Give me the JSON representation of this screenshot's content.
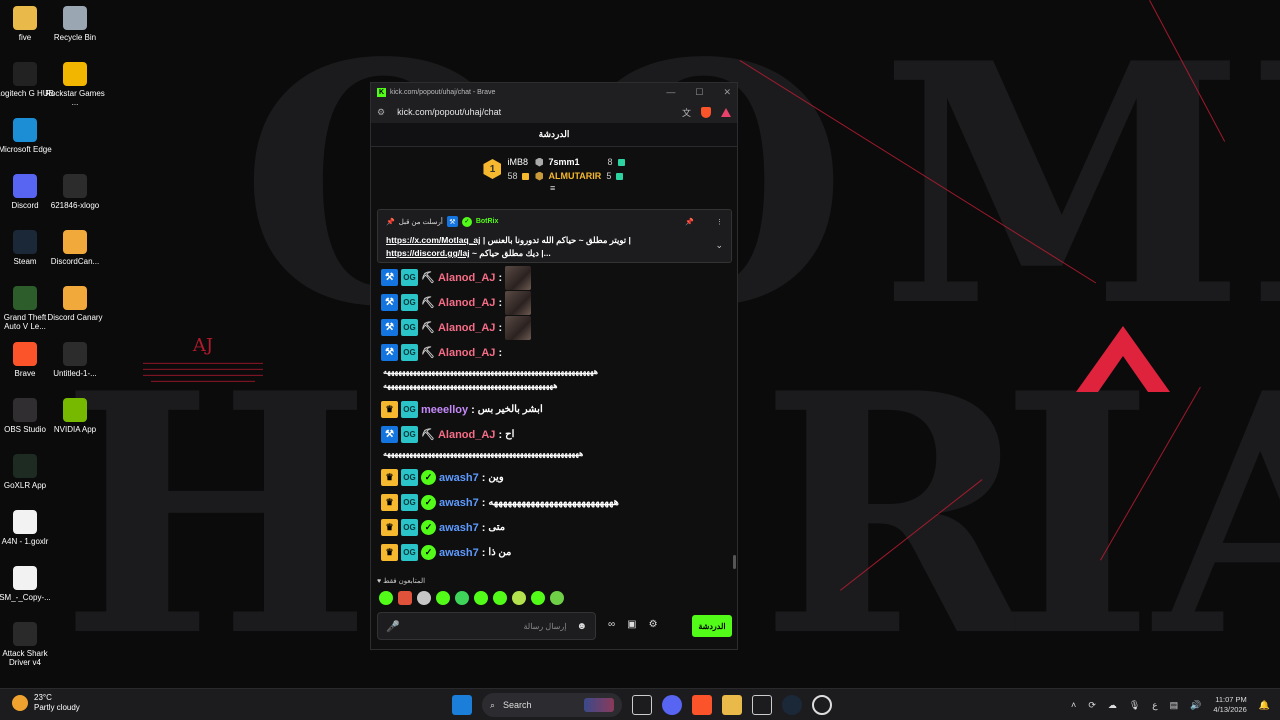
{
  "desktop_icons": [
    {
      "label": "five",
      "icon": "folder-icon",
      "color": "#e9b949"
    },
    {
      "label": "Recycle Bin",
      "icon": "recycle-bin-icon",
      "color": "#9aa6b2"
    },
    {
      "label": "Logitech G HUB",
      "icon": "logitech-icon",
      "color": "#222222"
    },
    {
      "label": "Rockstar Games ...",
      "icon": "rockstar-icon",
      "color": "#f2b600"
    },
    {
      "label": "Microsoft Edge",
      "icon": "edge-icon",
      "color": "#1b8ed6"
    },
    {
      "label": "Discord",
      "icon": "discord-icon",
      "color": "#5865f2"
    },
    {
      "label": "621846-xlogo",
      "icon": "image-file-icon",
      "color": "#2c2c2c"
    },
    {
      "label": "Steam",
      "icon": "steam-icon",
      "color": "#1b2838"
    },
    {
      "label": "DiscordCan...",
      "icon": "discord-canary-icon",
      "color": "#f2a93b"
    },
    {
      "label": "Grand Theft Auto V Le...",
      "icon": "gta-icon",
      "color": "#2d5d2a"
    },
    {
      "label": "Discord Canary",
      "icon": "discord-canary-icon",
      "color": "#f2a93b"
    },
    {
      "label": "Brave",
      "icon": "brave-icon",
      "color": "#fb542b"
    },
    {
      "label": "Untitled-1-...",
      "icon": "file-icon",
      "color": "#2c2c2c"
    },
    {
      "label": "OBS Studio",
      "icon": "obs-icon",
      "color": "#302e31"
    },
    {
      "label": "NVIDIA App",
      "icon": "nvidia-icon",
      "color": "#76b900"
    },
    {
      "label": "GoXLR App",
      "icon": "goxlr-icon",
      "color": "#1d2b22"
    },
    {
      "label": "A4N - 1.goxlr",
      "icon": "document-icon",
      "color": "#f2f2f2"
    },
    {
      "label": "SM_-_Copy-...",
      "icon": "document-icon",
      "color": "#f2f2f2"
    },
    {
      "label": "Attack Shark Driver v4",
      "icon": "mouse-driver-icon",
      "color": "#2a2a2a"
    }
  ],
  "wallpaper": {
    "aj_title": "AJ",
    "accent": "#c41d33"
  },
  "browser": {
    "tab_title": "kick.com/popout/uhaj/chat - Brave",
    "url": "kick.com/popout/uhaj/chat",
    "minimize": "—",
    "maximize": "☐",
    "close": "✕"
  },
  "chat": {
    "header": "الدردشة",
    "leaderboard": {
      "rank": "1",
      "first": {
        "name": "iMB8",
        "count": "58"
      },
      "second": {
        "name": "7smm1",
        "count": "8"
      },
      "third": {
        "name": "ALMUTARIR",
        "count": "5"
      }
    },
    "pinned": {
      "sent_by": "أرسلت من قبل",
      "bot": "BotRix",
      "line1_link": "https://x.com/Motlaq_aj",
      "line1_text": "| تويتر مطلق ~ حياكم الله تدورونا بالعنس |",
      "line2_link": "https://discord.gg/laj",
      "line2_text": "~ ديك مطلق حياكم |..."
    },
    "messages": [
      {
        "user": "Alanod_AJ",
        "text": "",
        "badges": "mod",
        "color": "#f76d86",
        "thumb": true
      },
      {
        "user": "Alanod_AJ",
        "text": "",
        "badges": "mod",
        "color": "#f76d86",
        "thumb": true
      },
      {
        "user": "Alanod_AJ",
        "text": "",
        "badges": "mod",
        "color": "#f76d86",
        "thumb": true
      },
      {
        "user": "Alanod_AJ",
        "text": "",
        "badges": "mod",
        "color": "#f76d86",
        "thumb": false
      },
      {
        "user": "meeelloy",
        "text": "ابشر بالخير بس",
        "badges": "sub",
        "color": "#c58af9",
        "thumb": false
      },
      {
        "user": "Alanod_AJ",
        "text": "اح",
        "badges": "mod",
        "color": "#f76d86",
        "thumb": false
      },
      {
        "user": "awash7",
        "text": "وين",
        "badges": "verified",
        "color": "#5e9bff",
        "thumb": false
      },
      {
        "user": "awash7",
        "text": "هههههههههههههههههههههههههههه",
        "badges": "verified",
        "color": "#5e9bff",
        "thumb": false
      },
      {
        "user": "awash7",
        "text": "متى",
        "badges": "verified",
        "color": "#5e9bff",
        "thumb": false
      },
      {
        "user": "awash7",
        "text": "من ذا",
        "badges": "verified",
        "color": "#5e9bff",
        "thumb": false
      }
    ],
    "spam_line_1": "هههههههههههههههههههههههههههههههههههههههههههههههههههههههههه",
    "spam_line_2": "ههههههههههههههههههههههههههههههههههههههههههههههه",
    "spam_line_3": "هههههههههههههههههههههههههههههههههههههههههههههههههههههه",
    "followers_only": "المتابعون فقط",
    "input_placeholder": "إرسال رسالة",
    "chat_button": "الدردشة"
  },
  "taskbar": {
    "temperature": "23°C",
    "weather": "Partly cloudy",
    "search_label": "Search",
    "time": "11:07 PM",
    "date": "4/13/2026",
    "lang": "ع"
  }
}
